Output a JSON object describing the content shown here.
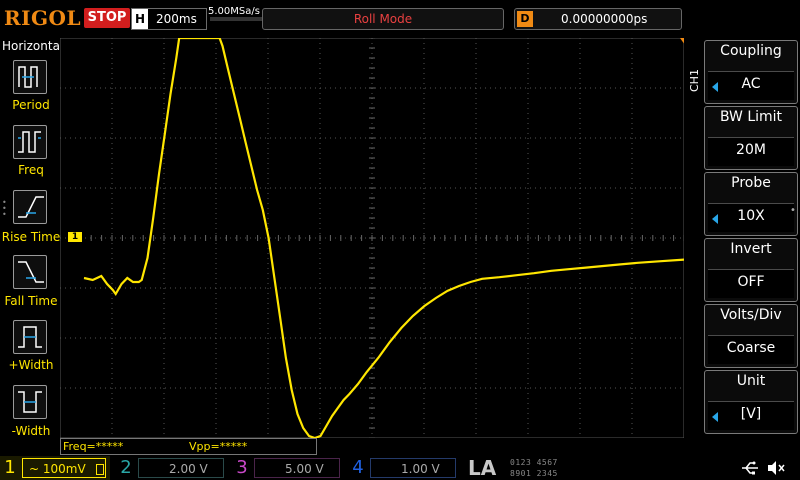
{
  "header": {
    "logo": "RIGOL",
    "run_status": "STOP",
    "horizontal_label": "H",
    "time_base": "200ms",
    "sample_rate": "5.00MSa/s",
    "mode": "Roll Mode",
    "delay_label": "D",
    "delay_value": "0.00000000ps"
  },
  "left_menu": {
    "title": "Horizontal",
    "items": [
      {
        "label": "Period",
        "icon": "period-icon"
      },
      {
        "label": "Freq",
        "icon": "freq-icon"
      },
      {
        "label": "Rise Time",
        "icon": "rise-time-icon"
      },
      {
        "label": "Fall Time",
        "icon": "fall-time-icon"
      },
      {
        "label": "+Width",
        "icon": "positive-width-icon"
      },
      {
        "label": "-Width",
        "icon": "negative-width-icon"
      }
    ]
  },
  "right_menu": {
    "channel_tag": "CH1",
    "items": [
      {
        "title": "Coupling",
        "value": "AC"
      },
      {
        "title": "BW Limit",
        "value": "20M"
      },
      {
        "title": "Probe",
        "value": "10X"
      },
      {
        "title": "Invert",
        "value": "OFF"
      },
      {
        "title": "Volts/Div",
        "value": "Coarse"
      },
      {
        "title": "Unit",
        "value": "[V]"
      }
    ]
  },
  "measurements": {
    "freq": "Freq=*****",
    "vpp": "Vpp=*****"
  },
  "channels": [
    {
      "num": "1",
      "scale": "100mV",
      "coupling_symbol": "~",
      "color": "#ffe600",
      "active": true
    },
    {
      "num": "2",
      "scale": "2.00 V",
      "color": "#29a6a6",
      "active": false
    },
    {
      "num": "3",
      "scale": "5.00 V",
      "color": "#c848c8",
      "active": false
    },
    {
      "num": "4",
      "scale": "1.00 V",
      "color": "#2060e0",
      "active": false
    }
  ],
  "la": {
    "label": "LA",
    "bits_row1": "0123  4567",
    "bits_row2": "8901  2345"
  },
  "trigger_marker": "1",
  "colors": {
    "ch1": "#ffe600",
    "brand": "#f08a14",
    "stop": "#d21e1e",
    "accent_blue": "#29a6e8"
  },
  "waveform": {
    "channel": "1",
    "points_div": [
      [
        0,
        4.0
      ],
      [
        0.15,
        3.95
      ],
      [
        0.3,
        4.05
      ],
      [
        0.4,
        3.85
      ],
      [
        0.5,
        3.7
      ],
      [
        0.55,
        3.6
      ],
      [
        0.65,
        3.85
      ],
      [
        0.75,
        4.0
      ],
      [
        0.85,
        3.9
      ],
      [
        0.95,
        3.9
      ],
      [
        1.0,
        3.95
      ],
      [
        1.1,
        4.5
      ],
      [
        1.2,
        5.5
      ],
      [
        1.3,
        6.6
      ],
      [
        1.4,
        7.6
      ],
      [
        1.5,
        8.6
      ],
      [
        1.6,
        9.5
      ],
      [
        1.65,
        10.0
      ],
      [
        2.35,
        10.0
      ],
      [
        2.4,
        9.8
      ],
      [
        2.5,
        9.2
      ],
      [
        2.6,
        8.6
      ],
      [
        2.7,
        8.0
      ],
      [
        2.8,
        7.4
      ],
      [
        2.9,
        6.8
      ],
      [
        3.0,
        6.2
      ],
      [
        3.1,
        5.7
      ],
      [
        3.2,
        5.0
      ],
      [
        3.3,
        4.0
      ],
      [
        3.4,
        3.0
      ],
      [
        3.5,
        2.0
      ],
      [
        3.6,
        1.2
      ],
      [
        3.7,
        0.6
      ],
      [
        3.8,
        0.25
      ],
      [
        3.9,
        0.05
      ],
      [
        4.0,
        0.0
      ],
      [
        4.1,
        0.05
      ],
      [
        4.2,
        0.3
      ],
      [
        4.3,
        0.55
      ],
      [
        4.4,
        0.75
      ],
      [
        4.5,
        0.95
      ],
      [
        4.6,
        1.1
      ],
      [
        4.75,
        1.35
      ],
      [
        4.9,
        1.65
      ],
      [
        5.1,
        2.0
      ],
      [
        5.3,
        2.4
      ],
      [
        5.5,
        2.75
      ],
      [
        5.7,
        3.05
      ],
      [
        5.9,
        3.3
      ],
      [
        6.1,
        3.5
      ],
      [
        6.3,
        3.68
      ],
      [
        6.5,
        3.8
      ],
      [
        6.7,
        3.9
      ],
      [
        6.9,
        3.98
      ],
      [
        7.2,
        4.02
      ],
      [
        7.5,
        4.07
      ],
      [
        7.8,
        4.12
      ],
      [
        8.1,
        4.18
      ],
      [
        8.4,
        4.22
      ],
      [
        8.7,
        4.26
      ],
      [
        9.0,
        4.3
      ],
      [
        9.3,
        4.34
      ],
      [
        9.6,
        4.38
      ],
      [
        10.0,
        4.42
      ],
      [
        10.4,
        4.46
      ]
    ]
  }
}
